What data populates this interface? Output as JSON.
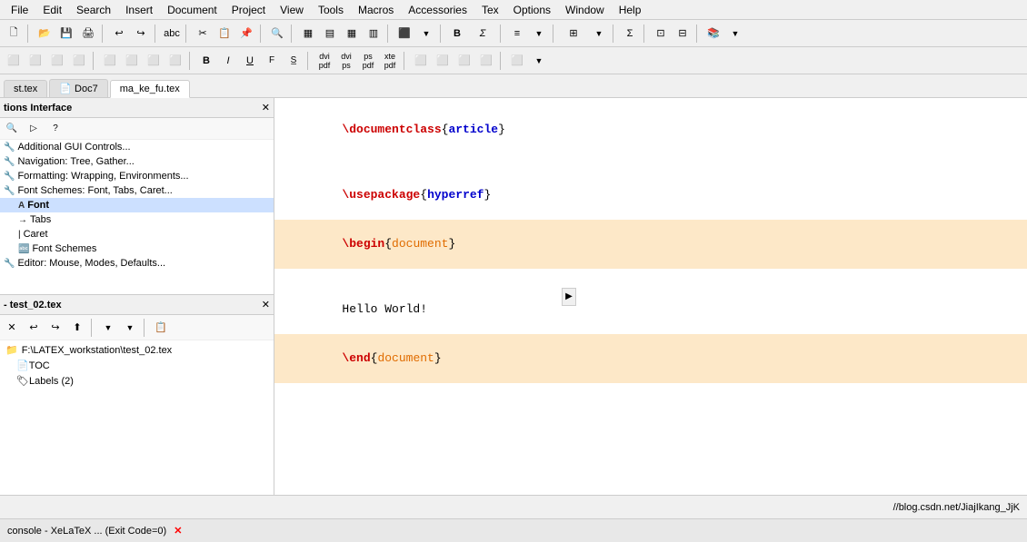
{
  "menubar": {
    "items": [
      "File",
      "Edit",
      "Search",
      "Insert",
      "Document",
      "Project",
      "View",
      "Tools",
      "Macros",
      "Accessories",
      "Tex",
      "Options",
      "Window",
      "Help"
    ]
  },
  "tabs": [
    {
      "label": "st.tex",
      "active": false
    },
    {
      "label": "Doc7",
      "active": false
    },
    {
      "label": "ma_ke_fu.tex",
      "active": true
    }
  ],
  "left_panel": {
    "title": "tions Interface",
    "tree_items": [
      {
        "label": "Additional GUI Controls...",
        "level": 0,
        "icon": "🔧"
      },
      {
        "label": "Navigation: Tree, Gather...",
        "level": 0,
        "icon": "🔧"
      },
      {
        "label": "Formatting: Wrapping, Environments...",
        "level": 0,
        "icon": "🔧"
      },
      {
        "label": "Font Schemes: Font, Tabs, Caret...",
        "level": 0,
        "icon": "🔧"
      },
      {
        "label": "Font",
        "level": 1,
        "selected": true,
        "icon": "A"
      },
      {
        "label": "Tabs",
        "level": 1,
        "icon": "→"
      },
      {
        "label": "Caret",
        "level": 1,
        "icon": "|"
      },
      {
        "label": "Font Schemes",
        "level": 1,
        "icon": "🔤"
      },
      {
        "label": "Editor: Mouse, Modes, Defaults...",
        "level": 0,
        "icon": "🔧"
      }
    ]
  },
  "file_panel": {
    "title": "- test_02.tex",
    "path": "F:\\LATEX_workstation\\test_02.tex",
    "items": [
      {
        "label": "TOC",
        "icon": "📄"
      },
      {
        "label": "Labels  (2)",
        "icon": "🏷"
      }
    ]
  },
  "editor": {
    "lines": [
      {
        "text": "\\documentclass{article}",
        "highlight": "none"
      },
      {
        "text": "",
        "highlight": "none"
      },
      {
        "text": "\\usepackage{hyperref}",
        "highlight": "none"
      },
      {
        "text": "\\begin{document}",
        "highlight": "orange"
      },
      {
        "text": "",
        "highlight": "none"
      },
      {
        "text": "Hello World!",
        "highlight": "none"
      },
      {
        "text": "\\end{document}",
        "highlight": "orange"
      }
    ]
  },
  "bottom_bar": {
    "text": "//blog.csdn.net/JiajIkang_JjK"
  },
  "console": {
    "label": "console - XeLaTeX ... (Exit Code=0)"
  },
  "icons": {
    "close": "✕",
    "arrow_right": "▶",
    "arrow_left": "◀",
    "check": "✓",
    "folder": "📁",
    "search": "🔍"
  }
}
